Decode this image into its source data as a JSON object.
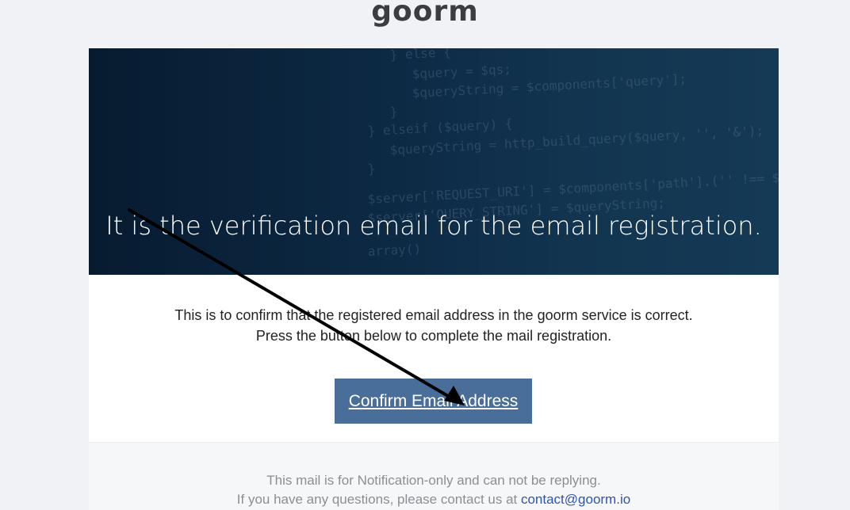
{
  "header": {
    "logo_text": "goorm"
  },
  "hero": {
    "title": "It is the verification email for the email registration.",
    "code_lines": [
      "} else {",
      "    $query = $qs;",
      "    $queryString = $components['query'];",
      "}",
      "} elseif ($query) {",
      "    $queryString = http_build_query($query, '', '&');",
      "}",
      "$server['REQUEST_URI'] = $components['path'].('' !== $queryStri",
      "$server['QUERY_STRING'] = $queryString;",
      "                                                     array()"
    ]
  },
  "body": {
    "line1": "This is to confirm that the registered email address in the goorm service is correct.",
    "line2": "Press the button below to complete the mail registration."
  },
  "cta": {
    "label": "Confirm Email Address",
    "color": "#4a6e9a"
  },
  "footer": {
    "line1": "This mail is for Notification-only and can not be replying.",
    "line2_prefix": "If you have any questions, please contact us at ",
    "contact_email": "contact@goorm.io"
  },
  "colors": {
    "page_bg": "#f1f2f6",
    "hero_bg": "#0d2a45",
    "link": "#2f56a8",
    "annotation_arrow": "#000000"
  }
}
